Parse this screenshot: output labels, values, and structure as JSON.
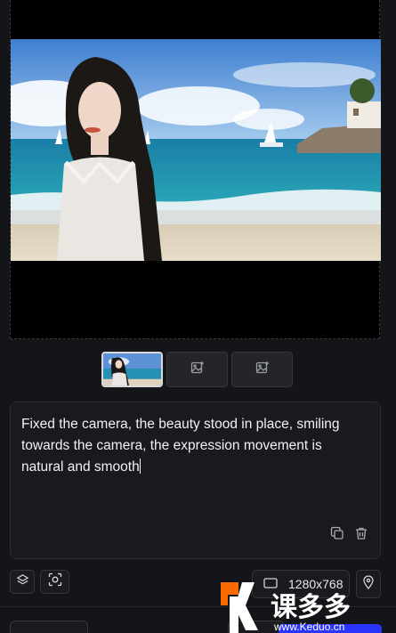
{
  "preview": {
    "image": "beach-portrait-image"
  },
  "thumbnails": [
    {
      "name": "thumbnail-image-1",
      "state": "selected"
    },
    {
      "name": "add-image-slot-2",
      "icon": "image-add-icon"
    },
    {
      "name": "add-image-slot-3",
      "icon": "image-add-icon"
    }
  ],
  "prompt": {
    "text": "Fixed the camera, the beauty stood in place, smiling towards the camera, the expression movement is natural and smooth"
  },
  "toolbar": {
    "resolution": "1280x768",
    "icons": [
      "layers-icon",
      "focus-scan-icon",
      "aspect-ratio-icon",
      "location-pin-icon",
      "copy-icon",
      "trash-icon"
    ]
  },
  "watermark": {
    "text": "课多多",
    "sub": "www.Keduo.cn"
  },
  "colors": {
    "background": "#141518",
    "accent": "#2a34ff",
    "watermark_orange": "#ff6a00"
  }
}
